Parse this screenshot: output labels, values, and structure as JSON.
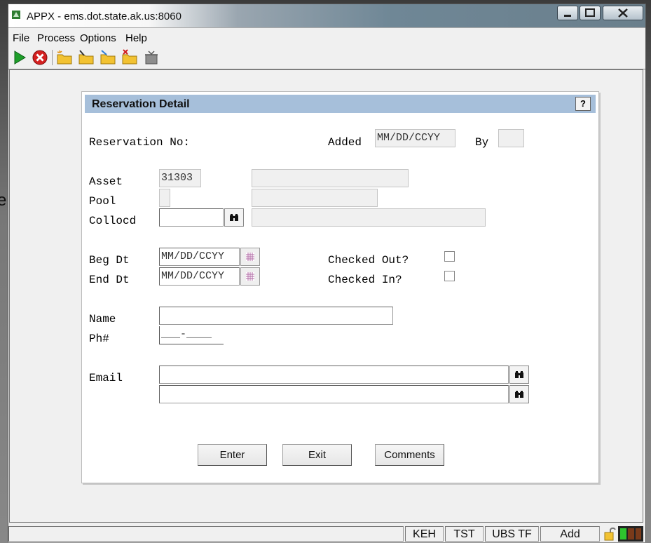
{
  "window": {
    "title": "APPX - ems.dot.state.ak.us:8060"
  },
  "background": {
    "partial_text": "er"
  },
  "menu": {
    "file": "File",
    "process": "Process",
    "options": "Options",
    "help": "Help"
  },
  "toolbar": {
    "icons": [
      "run-icon",
      "cancel-icon",
      "new-folder-icon",
      "edit-folder-icon",
      "folder-arrow-icon",
      "delete-folder-icon",
      "trash-icon"
    ]
  },
  "dialog": {
    "title": "Reservation Detail",
    "help_label": "?",
    "reservation_no_label": "Reservation No:",
    "added_label": "Added",
    "added_value": "MM/DD/CCYY",
    "by_label": "By",
    "by_value": "",
    "asset_label": "Asset",
    "asset_value": "31303",
    "asset_desc": "",
    "pool_label": "Pool",
    "pool_value": "",
    "pool_desc": "",
    "collocd_label": "Collocd",
    "collocd_value": "",
    "collocd_desc": "",
    "beg_dt_label": "Beg Dt",
    "beg_dt_value": "MM/DD/CCYY",
    "end_dt_label": "End Dt",
    "end_dt_value": "MM/DD/CCYY",
    "checked_out_label": "Checked Out?",
    "checked_in_label": "Checked In?",
    "checked_out": false,
    "checked_in": false,
    "name_label": "Name",
    "name_value": "",
    "phone_label": "Ph#",
    "phone_value": "___-____",
    "email_label": "Email",
    "email1_value": "",
    "email2_value": "",
    "enter_label": "Enter",
    "exit_label": "Exit",
    "comments_label": "Comments"
  },
  "status": {
    "user": "KEH",
    "env": "TST",
    "app": "UBS TF",
    "mode": "Add"
  }
}
